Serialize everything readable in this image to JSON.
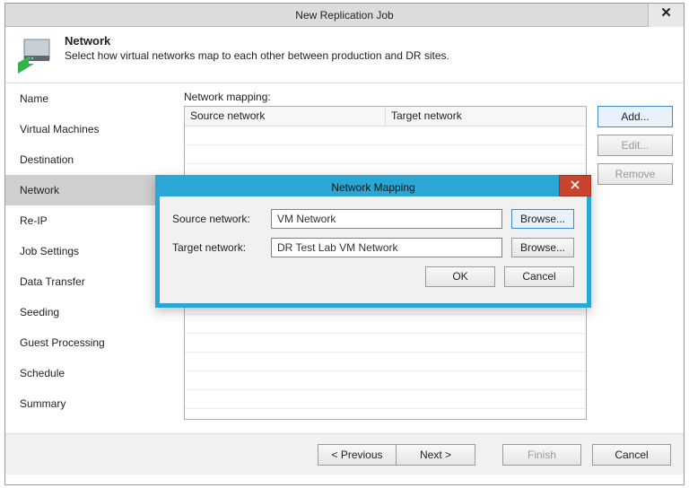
{
  "window": {
    "title": "New Replication Job",
    "close": "✕"
  },
  "header": {
    "title": "Network",
    "desc": "Select how virtual networks map to each other between production and DR sites."
  },
  "sidebar": {
    "items": [
      {
        "label": "Name"
      },
      {
        "label": "Virtual Machines"
      },
      {
        "label": "Destination"
      },
      {
        "label": "Network"
      },
      {
        "label": "Re-IP"
      },
      {
        "label": "Job Settings"
      },
      {
        "label": "Data Transfer"
      },
      {
        "label": "Seeding"
      },
      {
        "label": "Guest Processing"
      },
      {
        "label": "Schedule"
      },
      {
        "label": "Summary"
      }
    ],
    "selected_index": 3
  },
  "main": {
    "label": "Network mapping:",
    "columns": {
      "source": "Source network",
      "target": "Target network"
    },
    "buttons": {
      "add": "Add...",
      "edit": "Edit...",
      "remove": "Remove"
    }
  },
  "footer": {
    "prev": "< Previous",
    "next": "Next >",
    "finish": "Finish",
    "cancel": "Cancel"
  },
  "modal": {
    "title": "Network Mapping",
    "source_label": "Source network:",
    "target_label": "Target network:",
    "source_value": "VM Network",
    "target_value": "DR Test Lab VM Network",
    "browse": "Browse...",
    "ok": "OK",
    "cancel": "Cancel"
  }
}
